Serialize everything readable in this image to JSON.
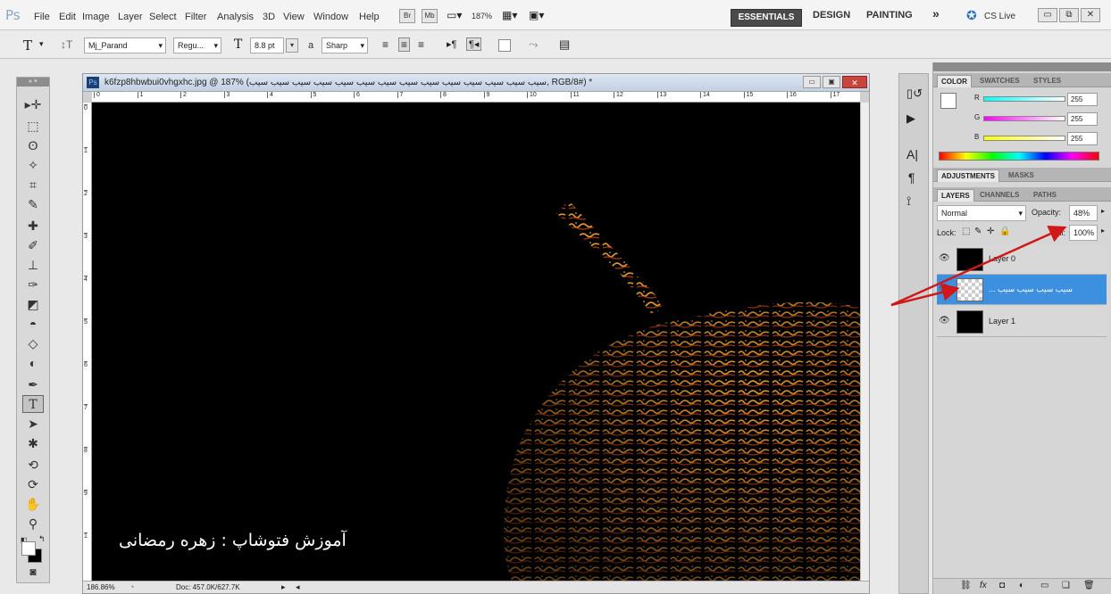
{
  "menubar": {
    "logo": "Ps",
    "items": [
      "File",
      "Edit",
      "Image",
      "Layer",
      "Select",
      "Filter",
      "Analysis",
      "3D",
      "View",
      "Window",
      "Help"
    ],
    "br": "Br",
    "mb": "Mb",
    "zoom": "187%",
    "workspaces": {
      "essentials": "ESSENTIALS",
      "design": "DESIGN",
      "painting": "PAINTING",
      "more": "»"
    },
    "cslive": "CS Live"
  },
  "options": {
    "tool_glyph": "T",
    "font_family": "Mj_Parand",
    "font_style": "Regu...",
    "font_size": "8.8 pt",
    "aa_label": "a",
    "aa_value": "Sharp"
  },
  "tools": {
    "header": "«  ×"
  },
  "document": {
    "title": "k6fzp8hbwbui0vhgxhc.jpg @ 187% (سیب سیب سیب سیب سیب سیب سیب سیب سیب سیب سیب سیب سیب سیب, RGB/8#) *",
    "ruler_top": [
      "0",
      "1",
      "2",
      "3",
      "4",
      "5",
      "6",
      "7",
      "8",
      "9",
      "10",
      "11",
      "12",
      "13",
      "14",
      "15",
      "16",
      "17"
    ],
    "ruler_left": [
      "0",
      "1",
      "2",
      "3",
      "4",
      "5",
      "6",
      "7",
      "8",
      "9",
      "1"
    ],
    "watermark": "آموزش فتوشاپ : زهره رمضانی",
    "status_zoom": "186.86%",
    "status_doc": "Doc: 457.0K/627.7K"
  },
  "color_panel": {
    "tabs": [
      "COLOR",
      "SWATCHES",
      "STYLES"
    ],
    "r_label": "R",
    "g_label": "G",
    "b_label": "B",
    "r": "255",
    "g": "255",
    "b": "255"
  },
  "adjust_panel": {
    "tabs": [
      "ADJUSTMENTS",
      "MASKS"
    ]
  },
  "layers_panel": {
    "tabs": [
      "LAYERS",
      "CHANNELS",
      "PATHS"
    ],
    "blend": "Normal",
    "opacity_label": "Opacity:",
    "opacity": "48%",
    "lock_label": "Lock:",
    "fill_label": "Fill:",
    "fill": "100%",
    "layers": [
      {
        "name": "Layer 0",
        "selected": false
      },
      {
        "name": "... سیب سیب سیب سیب",
        "selected": true
      },
      {
        "name": "Layer 1",
        "selected": false
      }
    ]
  },
  "colors": {
    "accent": "#3d8fe0",
    "arrow": "#d01818"
  }
}
